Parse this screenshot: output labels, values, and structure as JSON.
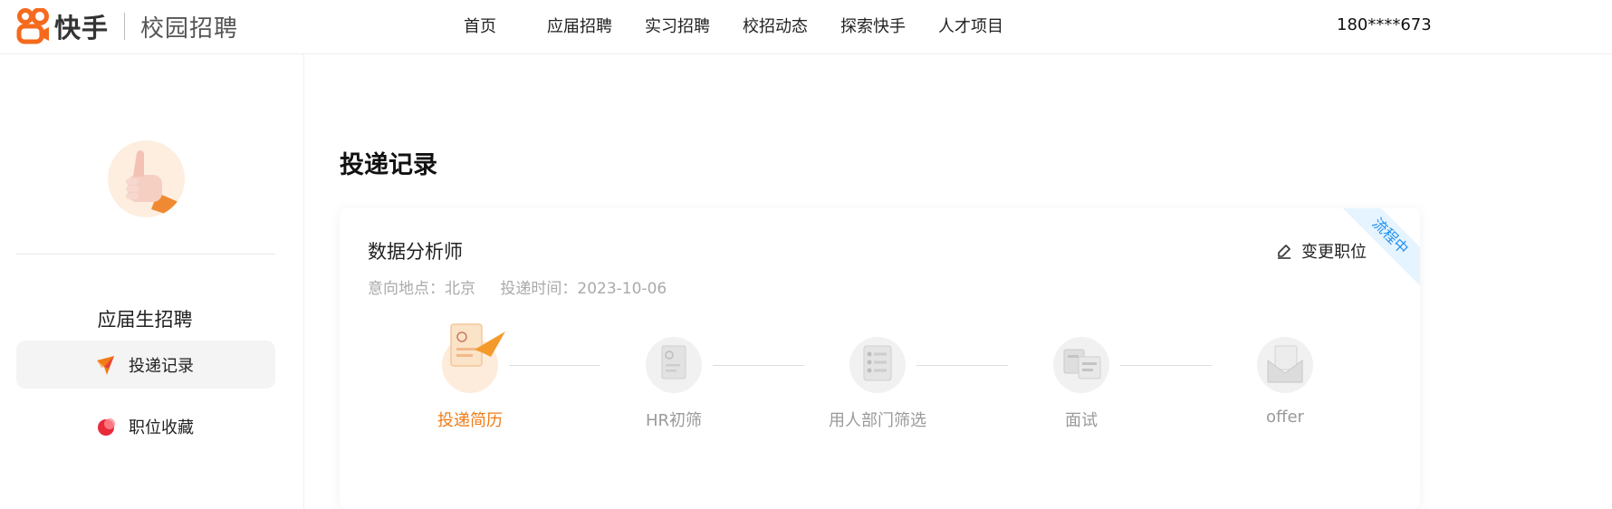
{
  "header": {
    "brand": "快手",
    "subtitle": "校园招聘",
    "nav": [
      "首页",
      "应届招聘",
      "实习招聘",
      "校招动态",
      "探索快手",
      "人才项目"
    ],
    "user_phone": "180****673"
  },
  "sidebar": {
    "section_title": "应届生招聘",
    "items": [
      {
        "label": "投递记录",
        "icon": "paper-plane-icon",
        "active": true
      },
      {
        "label": "职位收藏",
        "icon": "favorite-icon",
        "active": false
      }
    ]
  },
  "main": {
    "page_title": "投递记录",
    "application": {
      "job_title": "数据分析师",
      "location": "意向地点：北京",
      "submit_time": "投递时间：2023-10-06",
      "status_ribbon": "流程中",
      "change_label": "变更职位",
      "steps": [
        {
          "label": "投递简历",
          "done": true
        },
        {
          "label": "HR初筛",
          "done": false
        },
        {
          "label": "用人部门筛选",
          "done": false
        },
        {
          "label": "面试",
          "done": false
        },
        {
          "label": "offer",
          "done": false
        }
      ]
    }
  },
  "colors": {
    "brand_orange": "#f56a1d",
    "active_step": "#f07c17",
    "ribbon_text": "#1f8ff0"
  }
}
